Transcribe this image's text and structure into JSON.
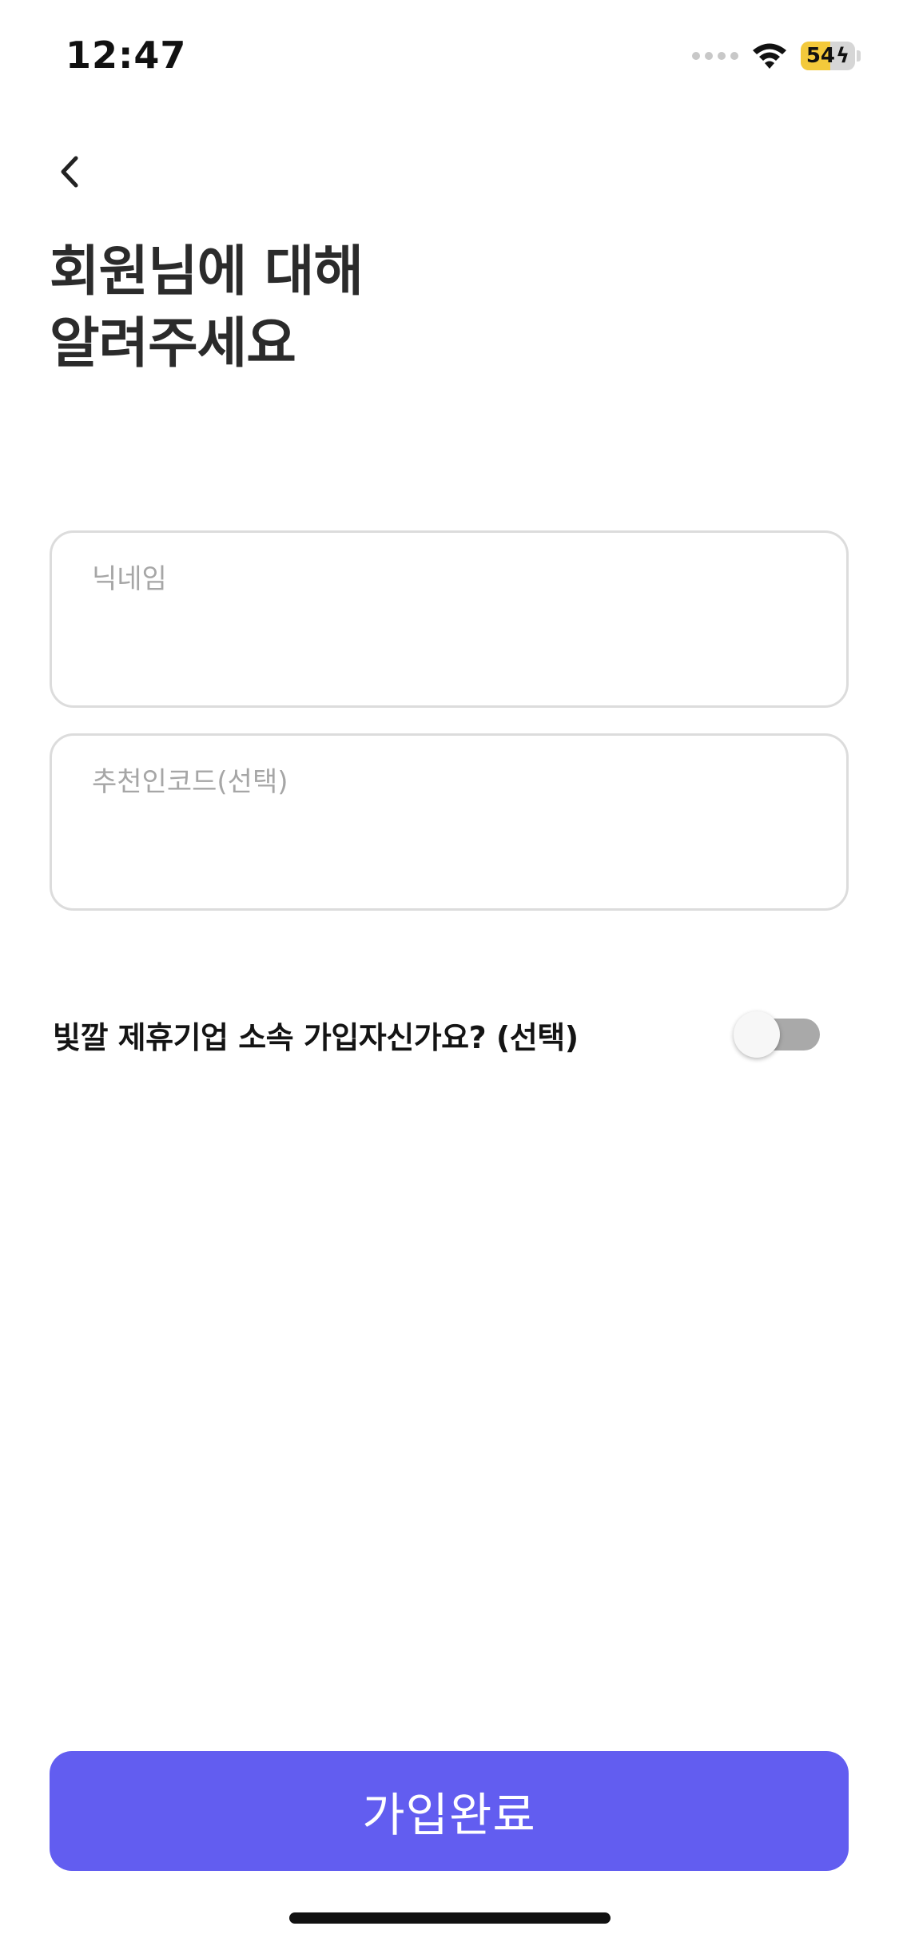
{
  "status_bar": {
    "time": "12:47",
    "battery_level": "54",
    "battery_charging_symbol": "ϟ",
    "icons": [
      "signal-icon",
      "wifi-icon",
      "battery-icon",
      "charging-bolt-icon"
    ]
  },
  "header": {
    "back_icon": "chevron-left-icon",
    "title_line_1": "회원님에 대해",
    "title_line_2": "알려주세요"
  },
  "form": {
    "nickname": {
      "placeholder": "닉네임",
      "value": ""
    },
    "referral_code": {
      "placeholder": "추천인코드(선택)",
      "value": ""
    },
    "affiliate_question": {
      "label": "빛깔 제휴기업 소속 가입자신가요? (선택)",
      "enabled": false
    }
  },
  "footer": {
    "submit_label": "가입완료"
  },
  "colors": {
    "accent": "#625df0",
    "toggle_off": "#a9a9a9",
    "battery_fill": "#f3c93b",
    "border": "#dcdcdc"
  }
}
